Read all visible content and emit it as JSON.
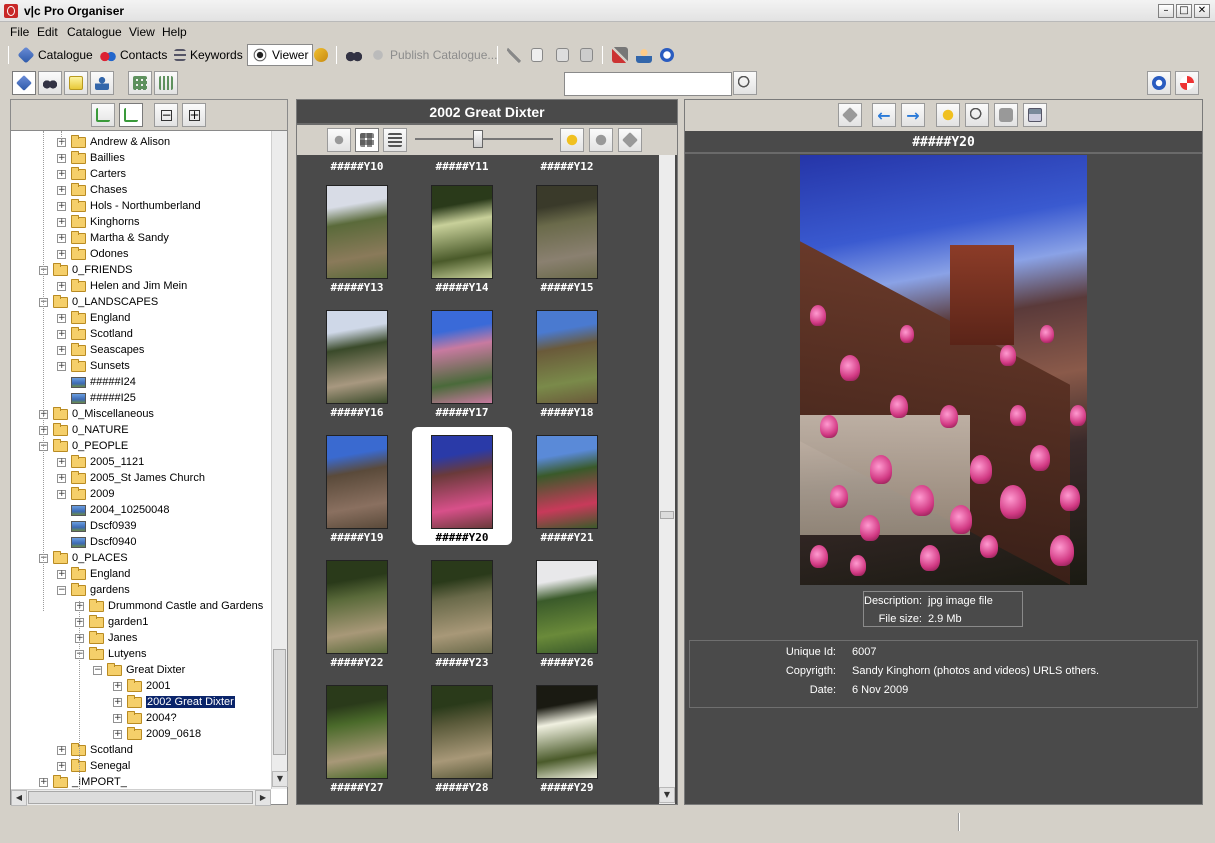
{
  "window": {
    "title": "v|c Pro Organiser"
  },
  "menu": [
    "File",
    "Edit",
    "Catalogue",
    "View",
    "Help"
  ],
  "toolbar": {
    "catalogue": "Catalogue",
    "contacts": "Contacts",
    "keywords": "Keywords",
    "viewer": "Viewer",
    "publish": "Publish Catalogue..."
  },
  "search": {
    "value": "",
    "placeholder": ""
  },
  "tree": {
    "items": [
      {
        "label": "Andrew & Alison",
        "level": 2,
        "type": "folder",
        "expander": "+"
      },
      {
        "label": "Baillies",
        "level": 2,
        "type": "folder",
        "expander": "+"
      },
      {
        "label": "Carters",
        "level": 2,
        "type": "folder",
        "expander": "+"
      },
      {
        "label": "Chases",
        "level": 2,
        "type": "folder",
        "expander": "+"
      },
      {
        "label": "Hols - Northumberland",
        "level": 2,
        "type": "folder",
        "expander": "+"
      },
      {
        "label": "Kinghorns",
        "level": 2,
        "type": "folder",
        "expander": "+"
      },
      {
        "label": "Martha & Sandy",
        "level": 2,
        "type": "folder",
        "expander": "+"
      },
      {
        "label": "Odones",
        "level": 2,
        "type": "folder",
        "expander": "+"
      },
      {
        "label": "0_FRIENDS",
        "level": 1,
        "type": "folder",
        "expander": "-"
      },
      {
        "label": "Helen and Jim Mein",
        "level": 2,
        "type": "folder",
        "expander": "+"
      },
      {
        "label": "0_LANDSCAPES",
        "level": 1,
        "type": "folder",
        "expander": "-"
      },
      {
        "label": "England",
        "level": 2,
        "type": "folder",
        "expander": "+"
      },
      {
        "label": "Scotland",
        "level": 2,
        "type": "folder",
        "expander": "+"
      },
      {
        "label": "Seascapes",
        "level": 2,
        "type": "folder",
        "expander": "+"
      },
      {
        "label": "Sunsets",
        "level": 2,
        "type": "folder",
        "expander": "+"
      },
      {
        "label": "#####I24",
        "level": 2,
        "type": "image",
        "expander": ""
      },
      {
        "label": "#####I25",
        "level": 2,
        "type": "image",
        "expander": ""
      },
      {
        "label": "0_Miscellaneous",
        "level": 1,
        "type": "folder",
        "expander": "+"
      },
      {
        "label": "0_NATURE",
        "level": 1,
        "type": "folder",
        "expander": "+"
      },
      {
        "label": "0_PEOPLE",
        "level": 1,
        "type": "folder",
        "expander": "-"
      },
      {
        "label": "2005_1121",
        "level": 2,
        "type": "folder",
        "expander": "+"
      },
      {
        "label": "2005_St James Church",
        "level": 2,
        "type": "folder",
        "expander": "+"
      },
      {
        "label": "2009",
        "level": 2,
        "type": "folder",
        "expander": "+"
      },
      {
        "label": "2004_10250048",
        "level": 2,
        "type": "image",
        "expander": ""
      },
      {
        "label": "Dscf0939",
        "level": 2,
        "type": "image",
        "expander": ""
      },
      {
        "label": "Dscf0940",
        "level": 2,
        "type": "image",
        "expander": ""
      },
      {
        "label": "0_PLACES",
        "level": 1,
        "type": "folder",
        "expander": "-"
      },
      {
        "label": "England",
        "level": 2,
        "type": "folder",
        "expander": "+"
      },
      {
        "label": "gardens",
        "level": 2,
        "type": "folder",
        "expander": "-"
      },
      {
        "label": "Drummond Castle and Gardens",
        "level": 3,
        "type": "folder",
        "expander": "+"
      },
      {
        "label": "garden1",
        "level": 3,
        "type": "folder",
        "expander": "+"
      },
      {
        "label": "Janes",
        "level": 3,
        "type": "folder",
        "expander": "+"
      },
      {
        "label": "Lutyens",
        "level": 3,
        "type": "folder",
        "expander": "-"
      },
      {
        "label": "Great Dixter",
        "level": 4,
        "type": "folder",
        "expander": "-"
      },
      {
        "label": "2001",
        "level": 5,
        "type": "folder",
        "expander": "+"
      },
      {
        "label": "2002 Great Dixter",
        "level": 5,
        "type": "folder",
        "expander": "+",
        "selected": true
      },
      {
        "label": "2004?",
        "level": 5,
        "type": "folder",
        "expander": "+"
      },
      {
        "label": "2009_0618",
        "level": 5,
        "type": "folder",
        "expander": "+"
      },
      {
        "label": "Scotland",
        "level": 2,
        "type": "folder",
        "expander": "+"
      },
      {
        "label": "Senegal",
        "level": 2,
        "type": "folder",
        "expander": "+"
      },
      {
        "label": "_IMPORT_",
        "level": 1,
        "type": "folder",
        "expander": "+"
      }
    ]
  },
  "gallery": {
    "title": "2002 Great Dixter",
    "top_labels": [
      "#####Y10",
      "#####Y11",
      "#####Y12"
    ],
    "items": [
      {
        "label": "#####Y13",
        "colors": [
          "#d8dce6",
          "#5a6a3a",
          "#8a7a5a"
        ]
      },
      {
        "label": "#####Y14",
        "colors": [
          "#2a3a1a",
          "#c8d09a",
          "#4a5a2a"
        ]
      },
      {
        "label": "#####Y15",
        "colors": [
          "#3a3a2a",
          "#6a6a4a",
          "#8a8070"
        ]
      },
      {
        "label": "#####Y16",
        "colors": [
          "#cfd8e8",
          "#3a4a2a",
          "#a89880"
        ]
      },
      {
        "label": "#####Y17",
        "colors": [
          "#3a6ad8",
          "#c87aa0",
          "#4a6a3a"
        ]
      },
      {
        "label": "#####Y18",
        "colors": [
          "#4a7ad0",
          "#6a5a3a",
          "#7a8a4a"
        ]
      },
      {
        "label": "#####Y19",
        "colors": [
          "#3a6ad0",
          "#5a4a3a",
          "#8a7060"
        ]
      },
      {
        "label": "#####Y20",
        "colors": [
          "#2a3aa8",
          "#6a3a3a",
          "#d8508a"
        ],
        "selected": true
      },
      {
        "label": "#####Y21",
        "colors": [
          "#5a8ad8",
          "#3a5a2a",
          "#c83a5a"
        ]
      },
      {
        "label": "#####Y22",
        "colors": [
          "#2a3a1a",
          "#5a6a3a",
          "#a89878"
        ]
      },
      {
        "label": "#####Y23",
        "colors": [
          "#2a3a1a",
          "#6a6a4a",
          "#a89878"
        ]
      },
      {
        "label": "#####Y26",
        "colors": [
          "#e8e8ea",
          "#3a5a2a",
          "#6a8a3a"
        ]
      },
      {
        "label": "#####Y27",
        "colors": [
          "#2a3a1a",
          "#4a6a2a",
          "#a89878"
        ]
      },
      {
        "label": "#####Y28",
        "colors": [
          "#2a3a1a",
          "#5a5a3a",
          "#a89878"
        ]
      },
      {
        "label": "#####Y29",
        "colors": [
          "#1a1a12",
          "#f0f0e0",
          "#4a5a2a"
        ]
      }
    ]
  },
  "viewer": {
    "title": "#####Y20",
    "description_label": "Description:",
    "description": "jpg image file",
    "filesize_label": "File size:",
    "filesize": "2.9 Mb",
    "unique_id_label": "Unique Id:",
    "unique_id": "6007",
    "copyright_label": "Copyrigth:",
    "copyright": "Sandy Kinghorn (photos and videos) URLS others.",
    "date_label": "Date:",
    "date": "6 Nov 2009"
  },
  "colors": {
    "panel_dark": "#4a4a4a",
    "chrome": "#d4d0c8",
    "selection": "#0a246a"
  }
}
